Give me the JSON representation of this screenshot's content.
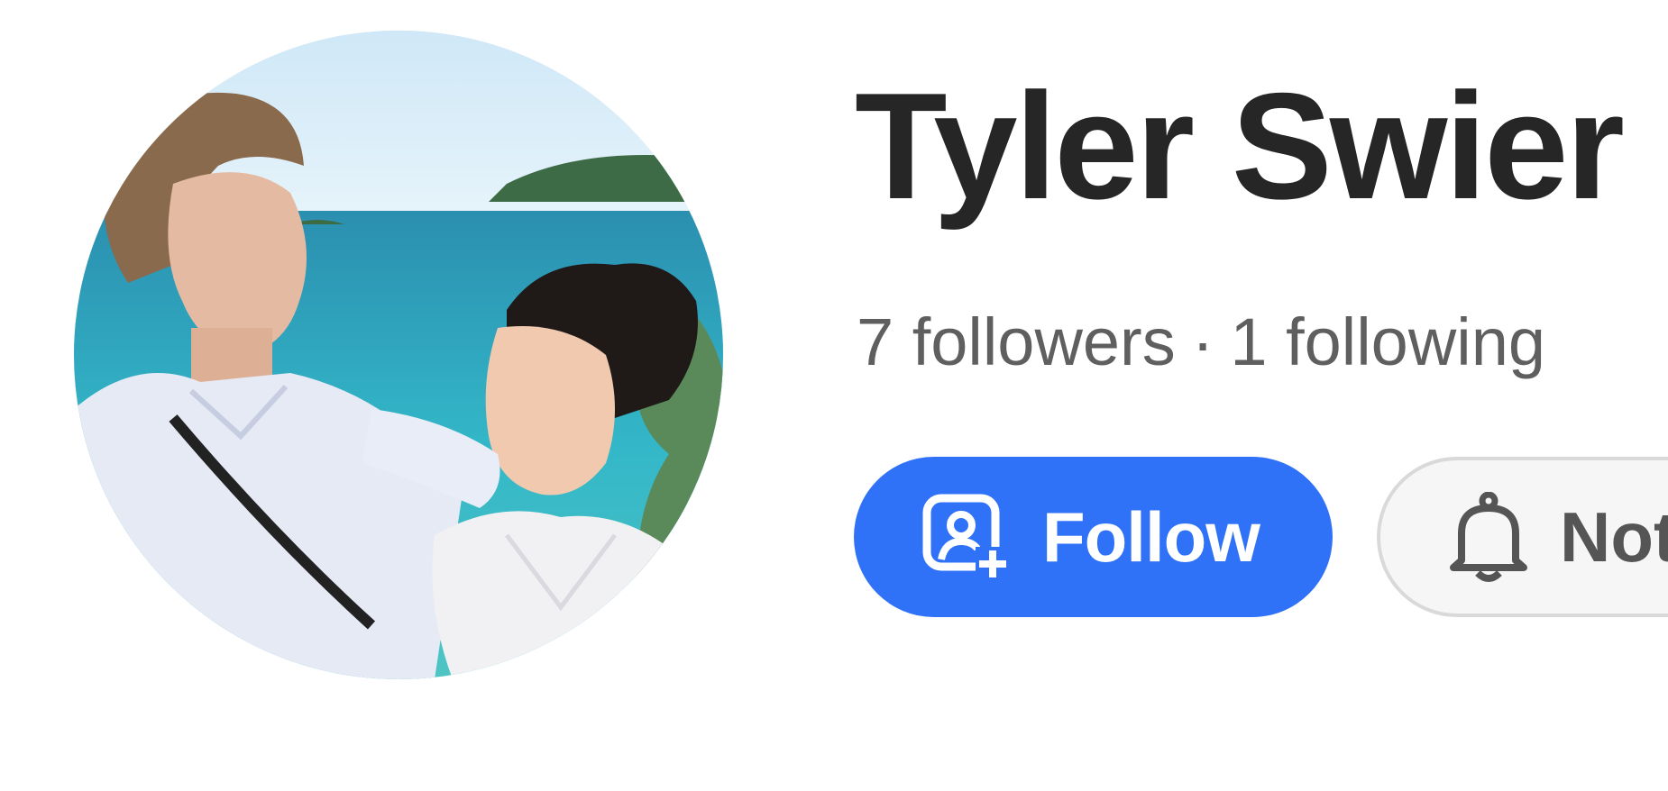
{
  "profile": {
    "name": "Tyler Swier",
    "followers_text": "7 followers",
    "separator": "·",
    "following_text": "1 following"
  },
  "actions": {
    "follow_label": "Follow",
    "follow_icon": "person-add-icon",
    "notify_label": "Notify",
    "notify_icon": "bell-icon"
  },
  "colors": {
    "primary": "#2f72f8",
    "name_text": "#262626",
    "secondary_text": "#5f5f5f"
  }
}
